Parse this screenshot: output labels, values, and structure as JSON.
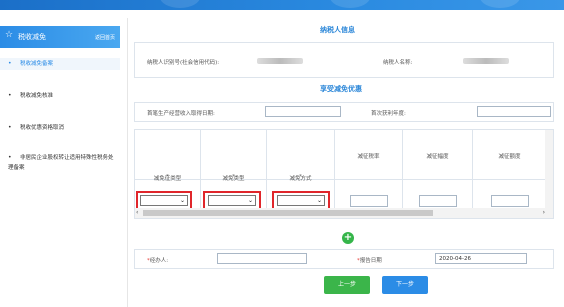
{
  "app": {
    "logo": "税务"
  },
  "sidebar": {
    "title": "税收减免",
    "home_link": "返回首页",
    "items": [
      {
        "label": "税收减免备案",
        "active": true
      },
      {
        "label": "税收减免核准",
        "active": false
      },
      {
        "label": "税收优惠资格取消",
        "active": false
      },
      {
        "label": "非居民企业股权转让适用特殊性税务处理备案",
        "active": false
      }
    ]
  },
  "taxpayer": {
    "section_title": "纳税人信息",
    "id_label": "纳税人识别号(社会信用代码):",
    "name_label": "纳税人名称:"
  },
  "benefit": {
    "section_title": "享受减免优惠",
    "first_income_label": "首笔生产经营收入取得日期:",
    "first_profit_label": "首次获利年度:"
  },
  "table": {
    "columns": [
      {
        "label": "减免征类型",
        "required": true
      },
      {
        "label": "减免类型",
        "required": true
      },
      {
        "label": "减免方式",
        "required": true
      },
      {
        "label": "减征税率",
        "required": false
      },
      {
        "label": "减征幅度",
        "required": false
      },
      {
        "label": "减征额度",
        "required": false
      }
    ]
  },
  "footer": {
    "agent_label": "经办人:",
    "report_date_label": "报告日期",
    "report_date_value": "2020-04-26"
  },
  "buttons": {
    "prev": "上一步",
    "next": "下一步"
  },
  "colors": {
    "accent": "#2b8ce6",
    "green": "#3bb54a",
    "highlight": "#e0262b"
  }
}
